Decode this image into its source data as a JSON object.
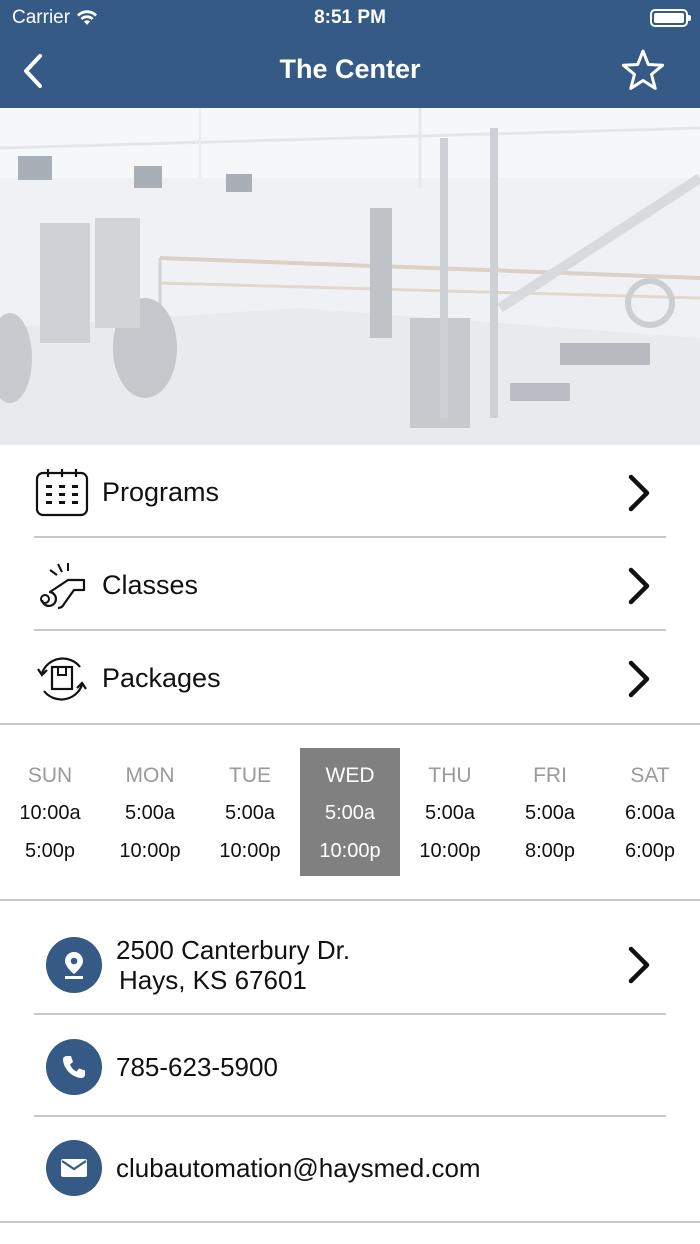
{
  "status_bar": {
    "carrier": "Carrier",
    "time": "8:51 PM"
  },
  "nav": {
    "title": "The Center"
  },
  "menu": [
    {
      "label": "Programs",
      "icon": "calendar-icon"
    },
    {
      "label": "Classes",
      "icon": "whistle-icon"
    },
    {
      "label": "Packages",
      "icon": "package-cycle-icon"
    }
  ],
  "schedule": {
    "days": [
      {
        "name": "SUN",
        "open": "10:00a",
        "close": "5:00p"
      },
      {
        "name": "MON",
        "open": "5:00a",
        "close": "10:00p"
      },
      {
        "name": "TUE",
        "open": "5:00a",
        "close": "10:00p"
      },
      {
        "name": "WED",
        "open": "5:00a",
        "close": "10:00p"
      },
      {
        "name": "THU",
        "open": "5:00a",
        "close": "10:00p"
      },
      {
        "name": "FRI",
        "open": "5:00a",
        "close": "8:00p"
      },
      {
        "name": "SAT",
        "open": "6:00a",
        "close": "6:00p"
      }
    ],
    "selected_day": "WED"
  },
  "contact": {
    "address_line1": "2500 Canterbury Dr.",
    "address_line2": "Hays, KS 67601",
    "phone": "785-623-5900",
    "email": "clubautomation@haysmed.com"
  },
  "colors": {
    "brand": "#355a85",
    "selected_day": "#808080",
    "divider": "#c8c8c8"
  }
}
